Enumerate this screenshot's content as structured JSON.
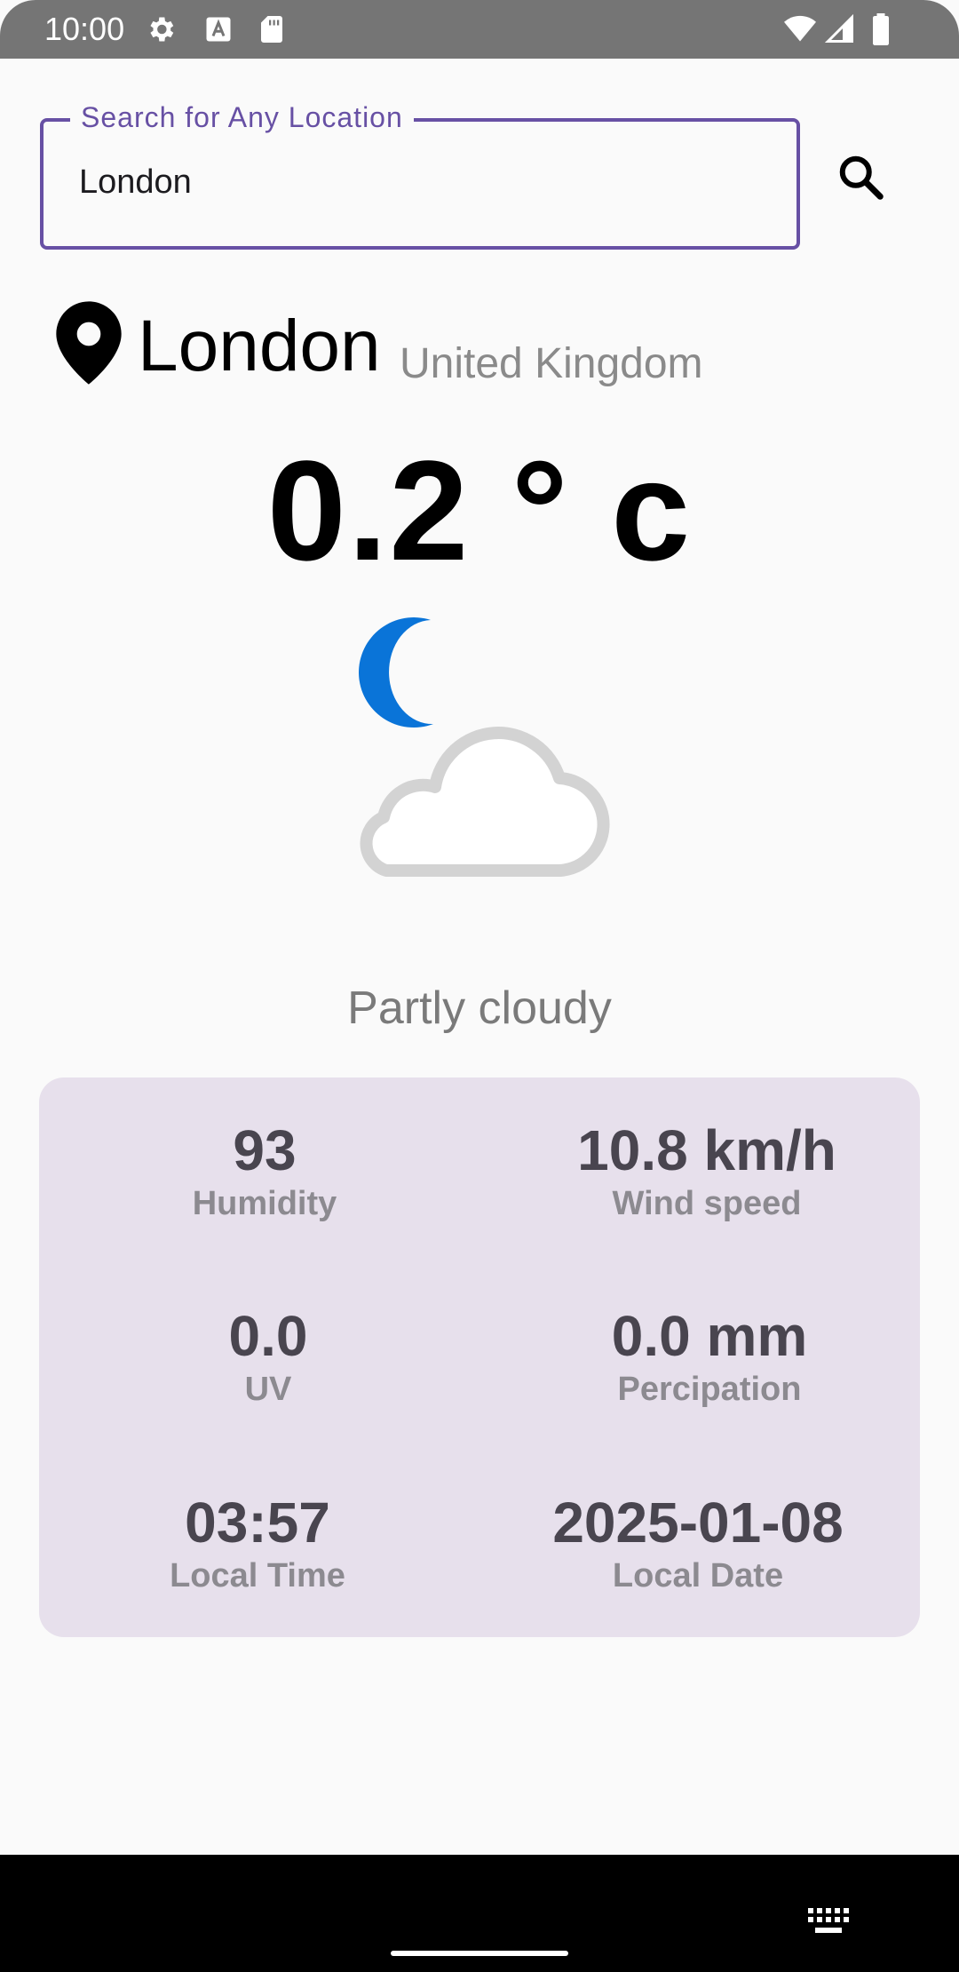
{
  "status_bar": {
    "time": "10:00",
    "icons": [
      "settings-gear-icon",
      "font-a-icon",
      "sd-card-icon",
      "wifi-icon",
      "signal-icon",
      "battery-icon"
    ]
  },
  "search": {
    "label": "Search for Any Location",
    "value": "London",
    "button_icon": "search-icon",
    "accent_color": "#6750a4"
  },
  "location": {
    "icon": "location-pin-icon",
    "city": "London",
    "country": "United Kingdom"
  },
  "weather": {
    "temperature": "0.2 ° c",
    "icon": "partly-cloudy-night-icon",
    "condition": "Partly cloudy"
  },
  "details": {
    "card_color": "#e7e0ec",
    "items": [
      {
        "value": "93",
        "label": "Humidity"
      },
      {
        "value": "10.8 km/h",
        "label": "Wind speed"
      },
      {
        "value": "0.0",
        "label": "UV"
      },
      {
        "value": "0.0 mm",
        "label": "Percipation"
      },
      {
        "value": "03:57",
        "label": "Local Time"
      },
      {
        "value": "2025-01-08",
        "label": "Local Date"
      }
    ]
  },
  "nav_bar": {
    "keyboard_icon": "keyboard-icon"
  }
}
